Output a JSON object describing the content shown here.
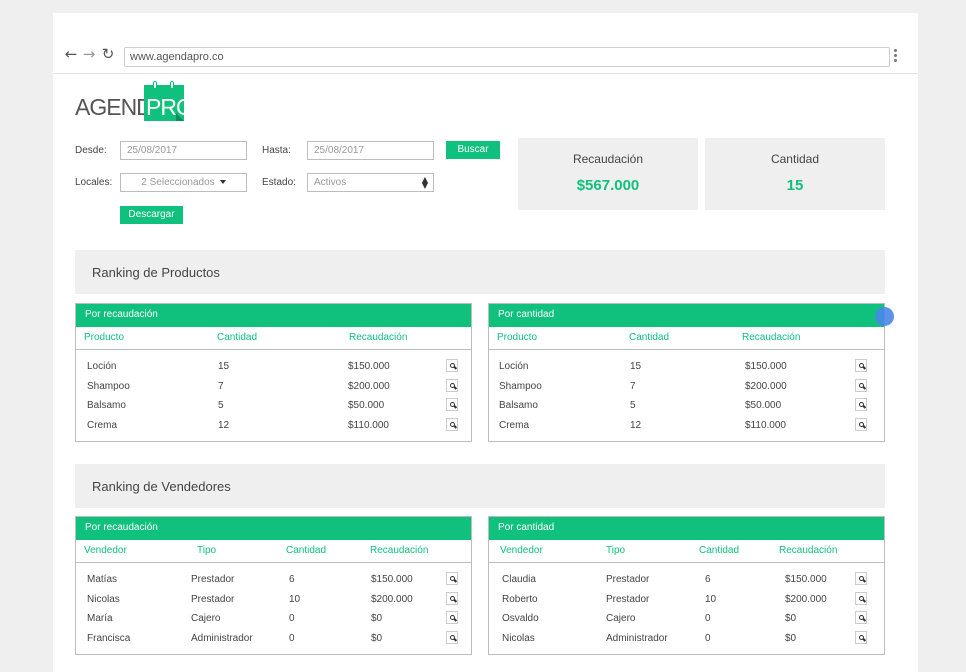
{
  "browser": {
    "url": "www.agendapro.co"
  },
  "logo": {
    "text_left": "AGENDA",
    "text_box": "PRO"
  },
  "filters": {
    "desde_label": "Desde:",
    "desde_value": "25/08/2017",
    "hasta_label": "Hasta:",
    "hasta_value": "25/08/2017",
    "buscar_label": "Buscar",
    "locales_label": "Locales:",
    "locales_value": "2 Seleccionados",
    "estado_label": "Estado:",
    "estado_value": "Activos",
    "descargar_label": "Descargar"
  },
  "stats": {
    "recaudacion_label": "Recaudación",
    "recaudacion_value": "$567.000",
    "cantidad_label": "Cantidad",
    "cantidad_value": "15"
  },
  "productos": {
    "title": "Ranking de Productos",
    "left": {
      "header": "Por recaudación",
      "columns": [
        "Producto",
        "Cantidad",
        "Recaudación"
      ],
      "rows": [
        {
          "name": "Loción",
          "qty": "15",
          "amount": "$150.000"
        },
        {
          "name": "Shampoo",
          "qty": "7",
          "amount": "$200.000"
        },
        {
          "name": "Balsamo",
          "qty": "5",
          "amount": "$50.000"
        },
        {
          "name": "Crema",
          "qty": "12",
          "amount": "$110.000"
        }
      ]
    },
    "right": {
      "header": "Por cantidad",
      "columns": [
        "Producto",
        "Cantidad",
        "Recaudación"
      ],
      "rows": [
        {
          "name": "Loción",
          "qty": "15",
          "amount": "$150.000"
        },
        {
          "name": "Shampoo",
          "qty": "7",
          "amount": "$200.000"
        },
        {
          "name": "Balsamo",
          "qty": "5",
          "amount": "$50.000"
        },
        {
          "name": "Crema",
          "qty": "12",
          "amount": "$110.000"
        }
      ]
    }
  },
  "vendedores": {
    "title": "Ranking de Vendedores",
    "left": {
      "header": "Por recaudación",
      "columns": [
        "Vendedor",
        "Tipo",
        "Cantidad",
        "Recaudación"
      ],
      "rows": [
        {
          "name": "Matías",
          "tipo": "Prestador",
          "qty": "6",
          "amount": "$150.000"
        },
        {
          "name": "Nicolas",
          "tipo": "Prestador",
          "qty": "10",
          "amount": "$200.000"
        },
        {
          "name": "María",
          "tipo": "Cajero",
          "qty": "0",
          "amount": "$0"
        },
        {
          "name": "Francisca",
          "tipo": "Administrador",
          "qty": "0",
          "amount": "$0"
        }
      ]
    },
    "right": {
      "header": "Por cantidad",
      "columns": [
        "Vendedor",
        "Tipo",
        "Cantidad",
        "Recaudación"
      ],
      "rows": [
        {
          "name": "Claudia",
          "tipo": "Prestador",
          "qty": "6",
          "amount": "$150.000"
        },
        {
          "name": "Roberto",
          "tipo": "Prestador",
          "qty": "10",
          "amount": "$200.000"
        },
        {
          "name": "Osvaldo",
          "tipo": "Cajero",
          "qty": "0",
          "amount": "$0"
        },
        {
          "name": "Nicolas",
          "tipo": "Administrador",
          "qty": "0",
          "amount": "$0"
        }
      ]
    }
  },
  "colors": {
    "accent": "#10c07d",
    "panel_bg": "#efefef",
    "cursor": "#4a86e8"
  }
}
